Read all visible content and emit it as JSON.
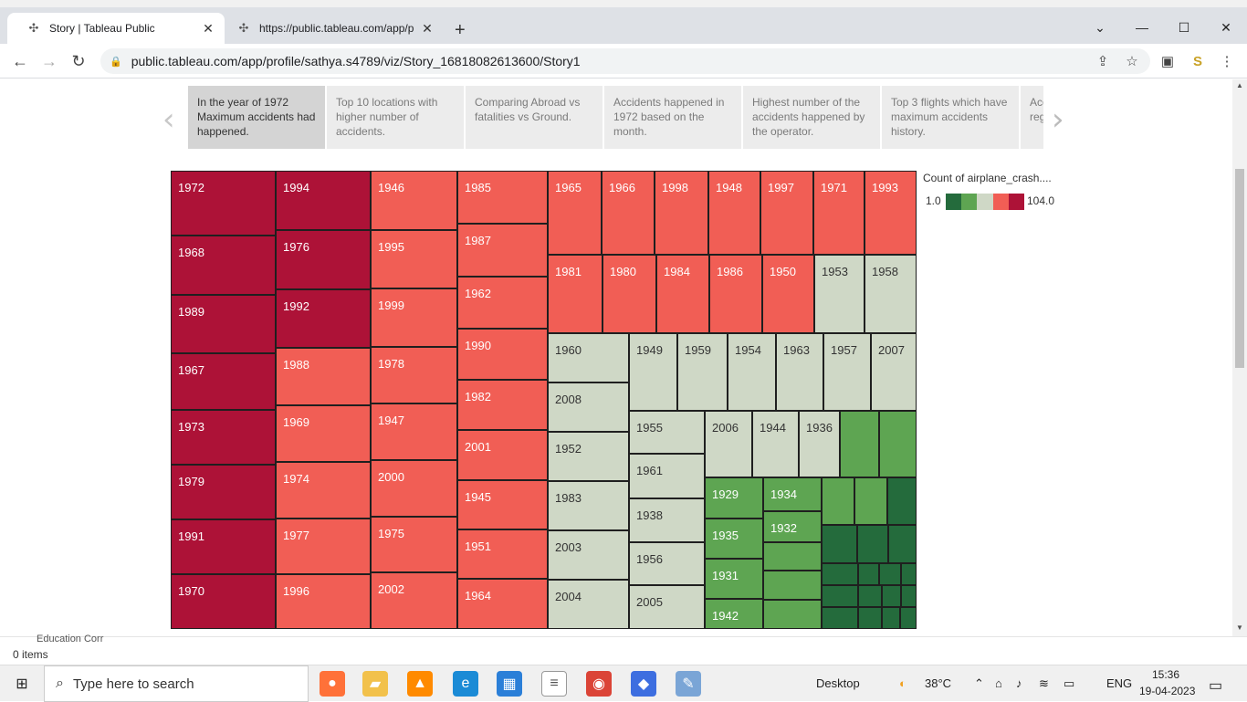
{
  "browser": {
    "tabs": [
      {
        "title": "Story | Tableau Public",
        "icon": "tableau-icon",
        "active": true
      },
      {
        "title": "https://public.tableau.com/app/p",
        "icon": "tableau-icon",
        "active": false
      }
    ],
    "url": "public.tableau.com/app/profile/sathya.s4789/viz/Story_16818082613600/Story1"
  },
  "story": {
    "points": [
      {
        "text": "In the year of 1972 Maximum accidents had happened.",
        "active": true
      },
      {
        "text": "Top 10 locations with higher number of accidents.",
        "active": false
      },
      {
        "text": "Comparing Abroad vs fatalities vs Ground.",
        "active": false
      },
      {
        "text": "Accidents happened in 1972 based on the month.",
        "active": false
      },
      {
        "text": "Highest number of the accidents happened by the operator.",
        "active": false
      },
      {
        "text": "Top 3 flights which have maximum accidents history.",
        "active": false
      },
      {
        "text": "Acc reg",
        "active": false
      }
    ]
  },
  "legend": {
    "title": "Count of airplane_crash....",
    "min": "1.0",
    "max": "104.0",
    "colors": [
      "#246b3c",
      "#5ea552",
      "#cfd8c6",
      "#f15e55",
      "#ad1237"
    ]
  },
  "chart_data": {
    "type": "treemap",
    "measure": "Count of airplane_crash....",
    "color_range": [
      1.0,
      104.0
    ],
    "labels": [
      "1972",
      "1968",
      "1989",
      "1967",
      "1973",
      "1979",
      "1991",
      "1970",
      "1994",
      "1976",
      "1992",
      "1988",
      "1969",
      "1974",
      "1977",
      "1996",
      "1946",
      "1995",
      "1999",
      "1978",
      "1947",
      "2000",
      "1975",
      "2002",
      "1985",
      "1987",
      "1962",
      "1990",
      "1982",
      "2001",
      "1945",
      "1951",
      "1964",
      "1965",
      "1966",
      "1998",
      "1948",
      "1997",
      "1971",
      "1993",
      "1981",
      "1980",
      "1984",
      "1986",
      "1950",
      "1953",
      "1958",
      "1960",
      "1949",
      "1959",
      "1954",
      "1963",
      "1957",
      "2007",
      "2008",
      "1955",
      "2006",
      "1944",
      "1936",
      "1952",
      "1961",
      "1983",
      "1938",
      "2003",
      "1956",
      "2004",
      "2005",
      "1929",
      "1934",
      "1932",
      "1935",
      "1931",
      "1942"
    ]
  },
  "status": {
    "items": "0 items",
    "ghost": "Education Corr"
  },
  "taskbar": {
    "search_placeholder": "Type here to search",
    "desktop": "Desktop",
    "temp": "38°C",
    "lang": "ENG",
    "time": "15:36",
    "date": "19-04-2023"
  }
}
